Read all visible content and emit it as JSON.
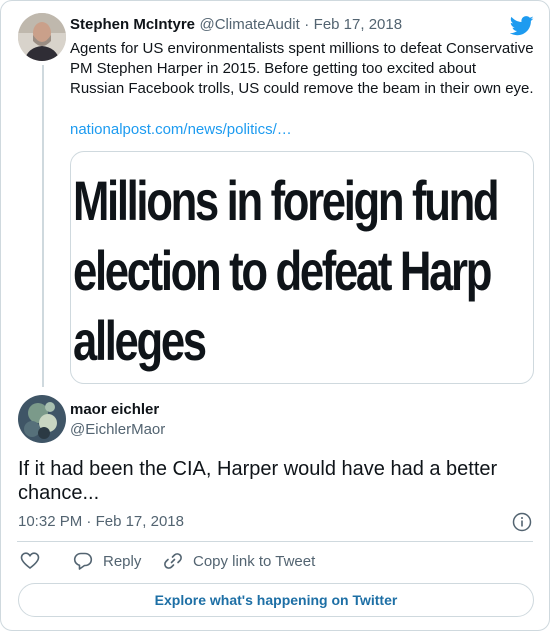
{
  "tweet": {
    "author_name": "Stephen McIntyre",
    "author_handle": "@ClimateAudit",
    "separator": "·",
    "date": "Feb 17, 2018",
    "text_line1": "Agents for US environmentalists spent millions to defeat Conservative",
    "text_line2": "PM Stephen Harper in 2015.  Before getting too excited about",
    "text_line3": "Russian Facebook trolls, US could remove the beam in their own eye.",
    "link": "nationalpost.com/news/politics/…",
    "media_headline": [
      "Millions in foreign fund",
      "election to defeat Harp",
      "alleges"
    ]
  },
  "reply": {
    "author_name": "maor eichler",
    "author_handle": "@EichlerMaor",
    "text_line1": "If it had been the CIA, Harper would have had a better",
    "text_line2": "chance...",
    "time": "10:32 PM",
    "separator": "·",
    "date": "Feb 17, 2018"
  },
  "actions": {
    "reply_label": "Reply",
    "copy_label": "Copy link to Tweet"
  },
  "footer": {
    "explore_label": "Explore what's happening on Twitter"
  },
  "colors": {
    "accent": "#1d9bf0",
    "muted": "#536471",
    "border": "#cfd9de"
  },
  "icons": [
    "twitter-logo-icon",
    "info-icon",
    "heart-icon",
    "reply-icon",
    "link-icon"
  ]
}
